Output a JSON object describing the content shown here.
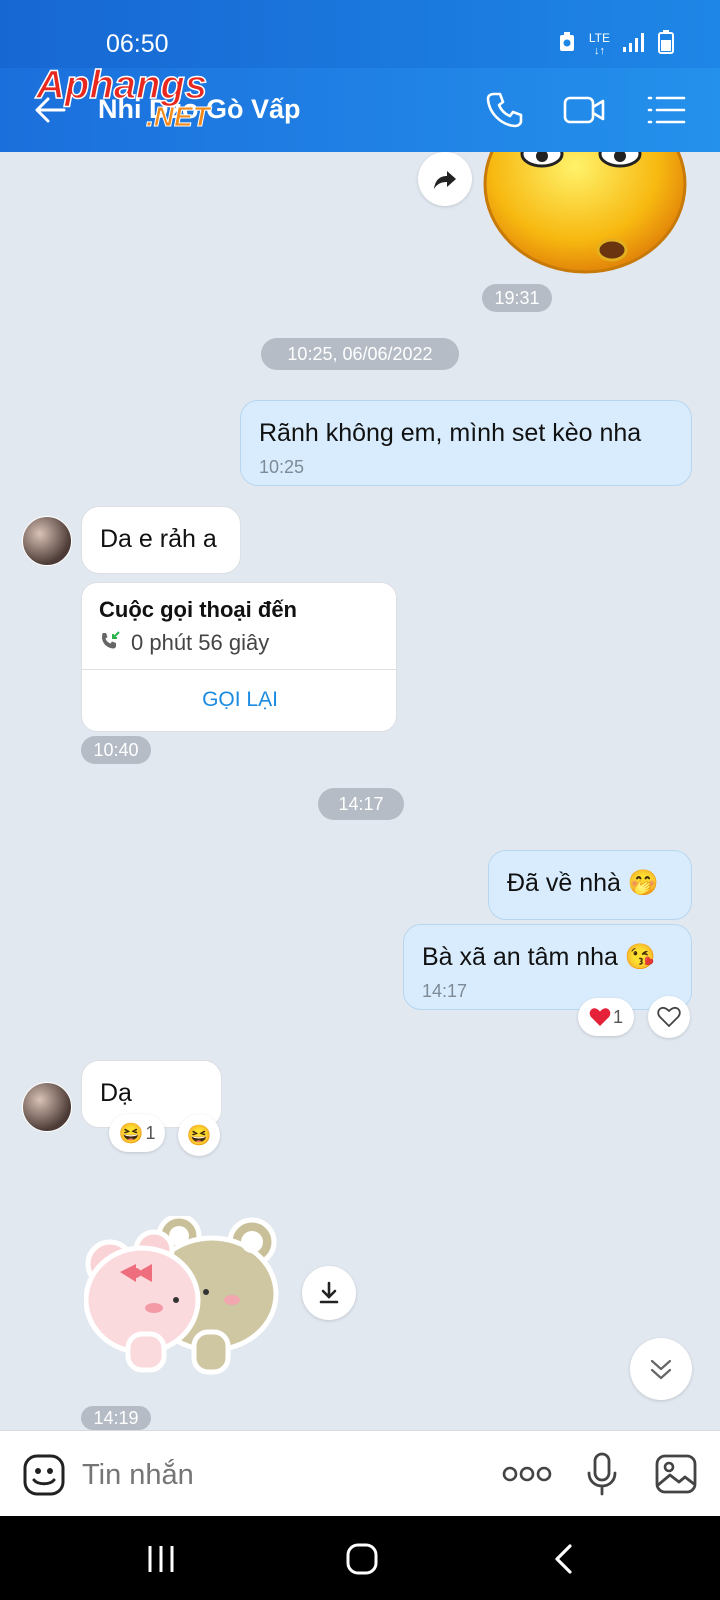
{
  "status": {
    "time": "06:50",
    "network": "LTE"
  },
  "header": {
    "contact_name": "Nhi Dzo Gò Vấp",
    "watermark": "Aphangs .NET"
  },
  "chat": {
    "sticker_time": "19:31",
    "date_divider": "10:25, 06/06/2022",
    "msg1": {
      "text": "Rãnh không em, mình set kèo nha",
      "time": "10:25"
    },
    "msg2": {
      "text": "Da e rảh a"
    },
    "call_card": {
      "title": "Cuộc gọi thoại đến",
      "duration": "0 phút 56 giây",
      "action": "GỌI LẠI",
      "time": "10:40"
    },
    "divider2": "14:17",
    "msg3": {
      "text": "Đã về nhà 🤭"
    },
    "msg4": {
      "text": "Bà xã an tâm nha 😘",
      "time": "14:17",
      "reaction_count": "1"
    },
    "msg5": {
      "text": "Dạ",
      "reaction_count": "1"
    },
    "sticker2_time": "14:19"
  },
  "input": {
    "placeholder": "Tin nhắn"
  },
  "colors": {
    "header": "#1e86e6",
    "accent": "#1a8be0",
    "outgoing": "#d9ecfd"
  }
}
